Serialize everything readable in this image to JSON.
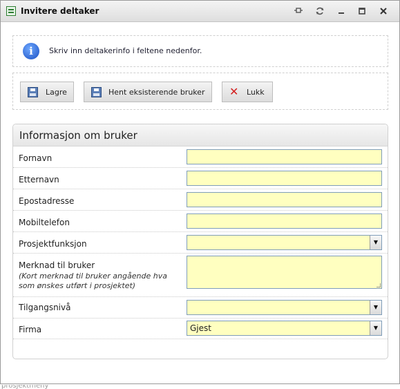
{
  "window": {
    "title": "Invitere deltaker",
    "controls": [
      "pin-icon",
      "refresh-icon",
      "minimize-icon",
      "maximize-icon",
      "close-icon"
    ]
  },
  "info": {
    "icon": "info-icon",
    "text": "Skriv inn deltakerinfo i feltene nedenfor."
  },
  "toolbar": {
    "save_label": "Lagre",
    "fetch_label": "Hent eksisterende bruker",
    "close_label": "Lukk"
  },
  "form": {
    "heading": "Informasjon om bruker",
    "fornavn": {
      "label": "Fornavn",
      "value": ""
    },
    "etternavn": {
      "label": "Etternavn",
      "value": ""
    },
    "epost": {
      "label": "Epostadresse",
      "value": ""
    },
    "mobil": {
      "label": "Mobiltelefon",
      "value": ""
    },
    "prosjektfunksjon": {
      "label": "Prosjektfunksjon",
      "value": ""
    },
    "merknad": {
      "label": "Merknad til bruker",
      "hint": "(Kort merknad til bruker angående hva som ønskes utført i prosjektet)",
      "value": ""
    },
    "tilgang": {
      "label": "Tilgangsnivå",
      "value": ""
    },
    "firma": {
      "label": "Firma",
      "value": "Gjest"
    }
  },
  "colors": {
    "field_bg": "#ffffc0",
    "field_border": "#7f9db9",
    "close_x": "#d32020"
  },
  "status": {
    "text": "prosjektmeny"
  }
}
